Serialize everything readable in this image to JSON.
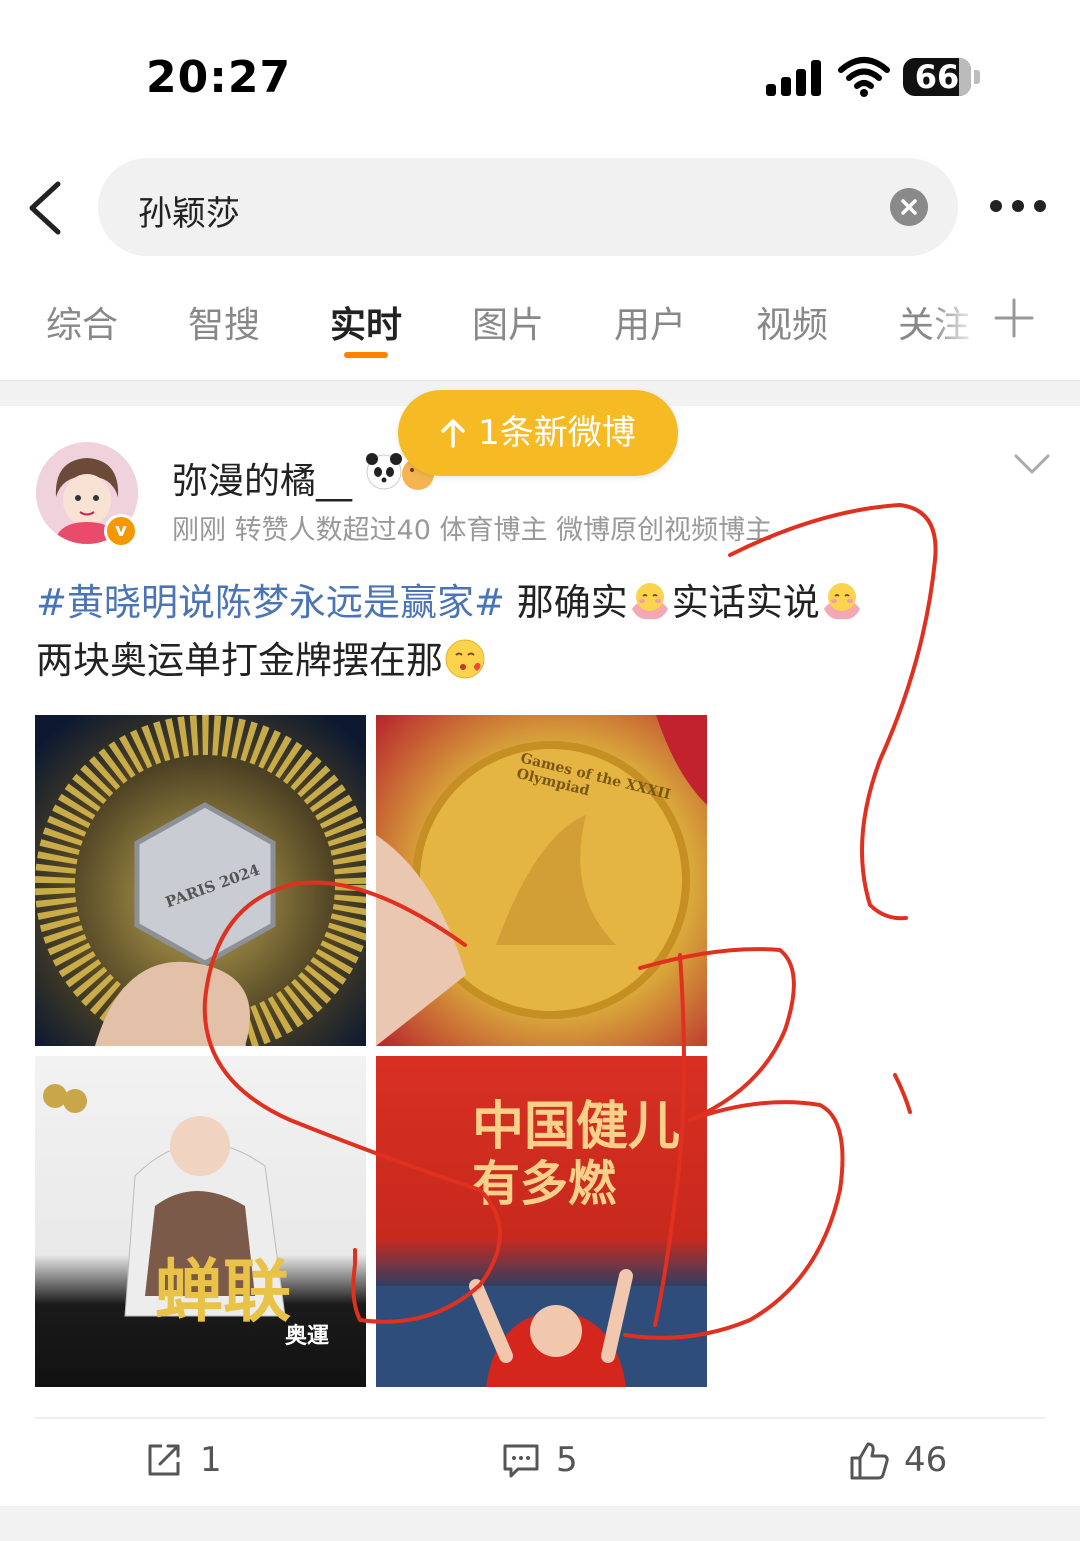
{
  "status_bar": {
    "time": "20:27",
    "battery": "66"
  },
  "search": {
    "query": "孙颖莎"
  },
  "tabs": [
    {
      "label": "综合"
    },
    {
      "label": "智搜"
    },
    {
      "label": "实时"
    },
    {
      "label": "图片"
    },
    {
      "label": "用户"
    },
    {
      "label": "视频"
    },
    {
      "label": "关注"
    }
  ],
  "active_tab": "实时",
  "new_posts_pill": {
    "label": "1条新微博"
  },
  "post": {
    "username": "弥漫的橘__",
    "meta": "刚刚 转赞人数超过40  体育博主 微博原创视频博主",
    "hashtag": "#黄晓明说陈梦永远是赢家#",
    "text_1": " 那确实",
    "text_2": "实话实说",
    "text_3": "两块奥运单打金牌摆在那",
    "images": [
      {
        "caption": "PARIS 2024"
      },
      {
        "caption": "Games of the XXXII Olympiad"
      },
      {
        "caption": "蝉联",
        "caption_2": "奥運"
      },
      {
        "caption": "中国健儿",
        "caption_2": "有多燃"
      }
    ],
    "actions": {
      "repost": "1",
      "comment": "5",
      "like": "46"
    }
  },
  "colors": {
    "accent": "#ff8200",
    "hashtag": "#4a74b5",
    "pill": "#f6ba25",
    "annotation": "#e03020"
  }
}
